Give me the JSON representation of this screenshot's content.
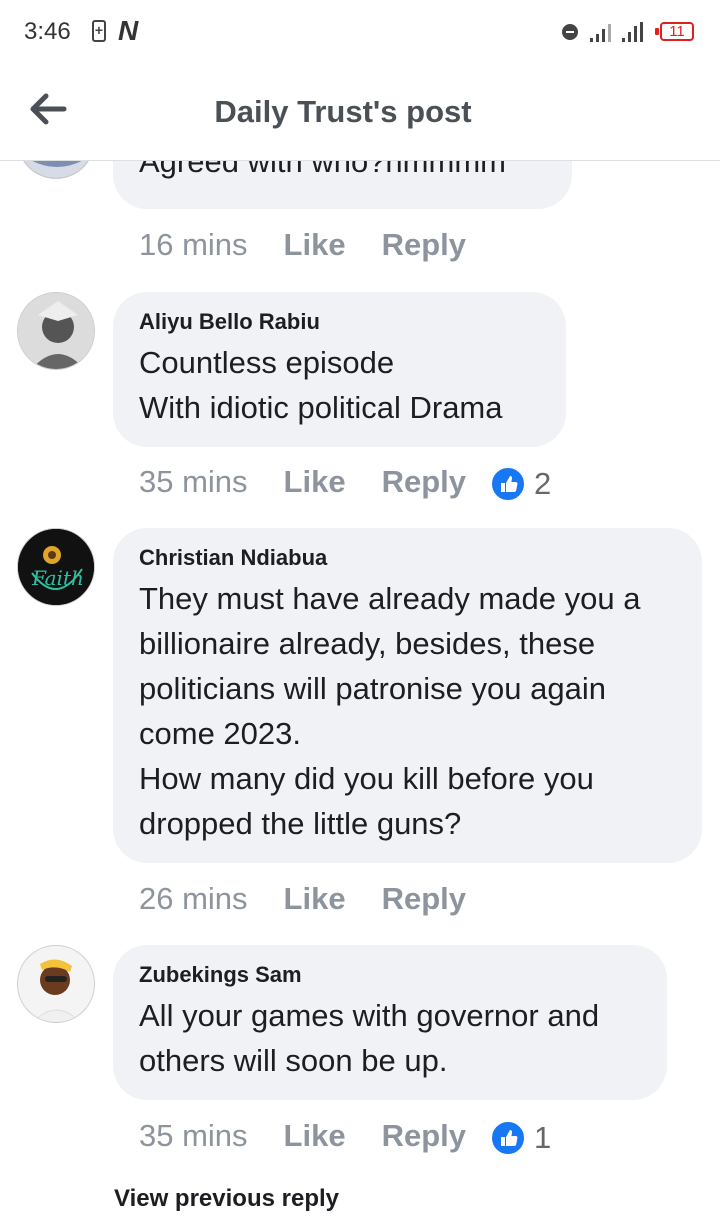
{
  "status_bar": {
    "time": "3:46",
    "battery_level": "11",
    "carrier_icon": "N"
  },
  "header": {
    "title": "Daily Trust's post"
  },
  "comments": [
    {
      "author": "",
      "lines": [
        "Agreed with who?hmmmm"
      ],
      "time": "16 mins",
      "like": "Like",
      "reply": "Reply",
      "reaction_count": ""
    },
    {
      "author": "Aliyu Bello Rabiu",
      "lines": [
        "Countless episode",
        "With idiotic political Drama"
      ],
      "time": "35 mins",
      "like": "Like",
      "reply": "Reply",
      "reaction_count": "2"
    },
    {
      "author": "Christian Ndiabua",
      "lines": [
        "They must have already made you a",
        "billionaire already, besides, these",
        "politicians will patronise you again",
        "come 2023.",
        "How many did you kill before you",
        "dropped the little guns?"
      ],
      "time": "26 mins",
      "like": "Like",
      "reply": "Reply",
      "reaction_count": ""
    },
    {
      "author": "Zubekings Sam",
      "lines": [
        "All your games with governor and",
        "others will soon be up."
      ],
      "time": "35 mins",
      "like": "Like",
      "reply": "Reply",
      "reaction_count": "1"
    }
  ],
  "view_previous_reply": "View previous reply",
  "avatar_text": "Faith",
  "colors": {
    "like_blue": "#1877f2",
    "bubble": "#f0f2f5",
    "meta_gray": "#8d949e",
    "battery_red": "#e0201b"
  }
}
